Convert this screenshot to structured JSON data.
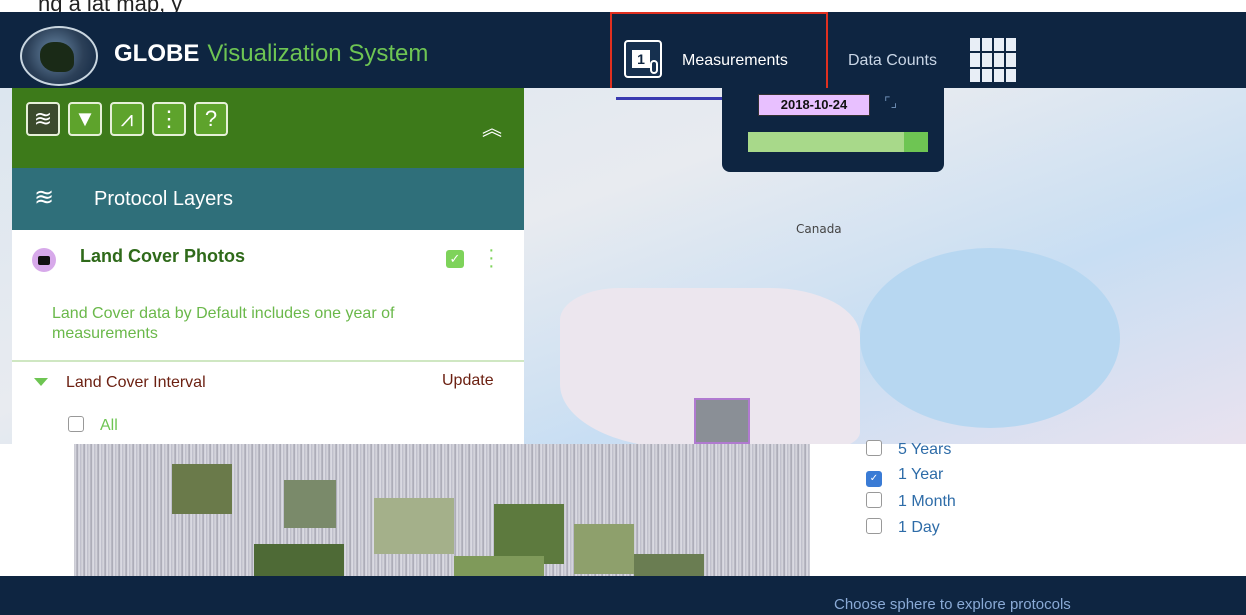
{
  "page": {
    "top_strip_text": "ng a lat map, y"
  },
  "header": {
    "brand_main": "GLOBE",
    "brand_sub": "Visualization System",
    "measurements_label": "Measurements",
    "data_counts_label": "Data Counts",
    "colors": {
      "bg": "#0e2541",
      "accent": "#6ec553",
      "highlight": "#e03020"
    }
  },
  "date_control": {
    "date": "2018-10-24",
    "slider_level": 1.0
  },
  "toolbar": {
    "tools": [
      "layers-icon",
      "filter-icon",
      "chart-icon",
      "compare-icon",
      "help-icon"
    ],
    "help_glyph": "?"
  },
  "panel": {
    "section_title": "Protocol Layers",
    "layer": {
      "title": "Land Cover Photos",
      "checked": true,
      "description": "Land Cover data by Default includes one year of measurements"
    },
    "interval": {
      "title": "Land Cover Interval",
      "update_label": "Update",
      "all_label": "All"
    }
  },
  "map": {
    "label_canada": "Canada"
  },
  "interval_options": [
    {
      "label": "5 Years",
      "checked": false
    },
    {
      "label": "1 Year",
      "checked": true
    },
    {
      "label": "1 Month",
      "checked": false
    },
    {
      "label": "1 Day",
      "checked": false
    }
  ],
  "footer": {
    "choose_text": "Choose sphere to explore protocols"
  }
}
